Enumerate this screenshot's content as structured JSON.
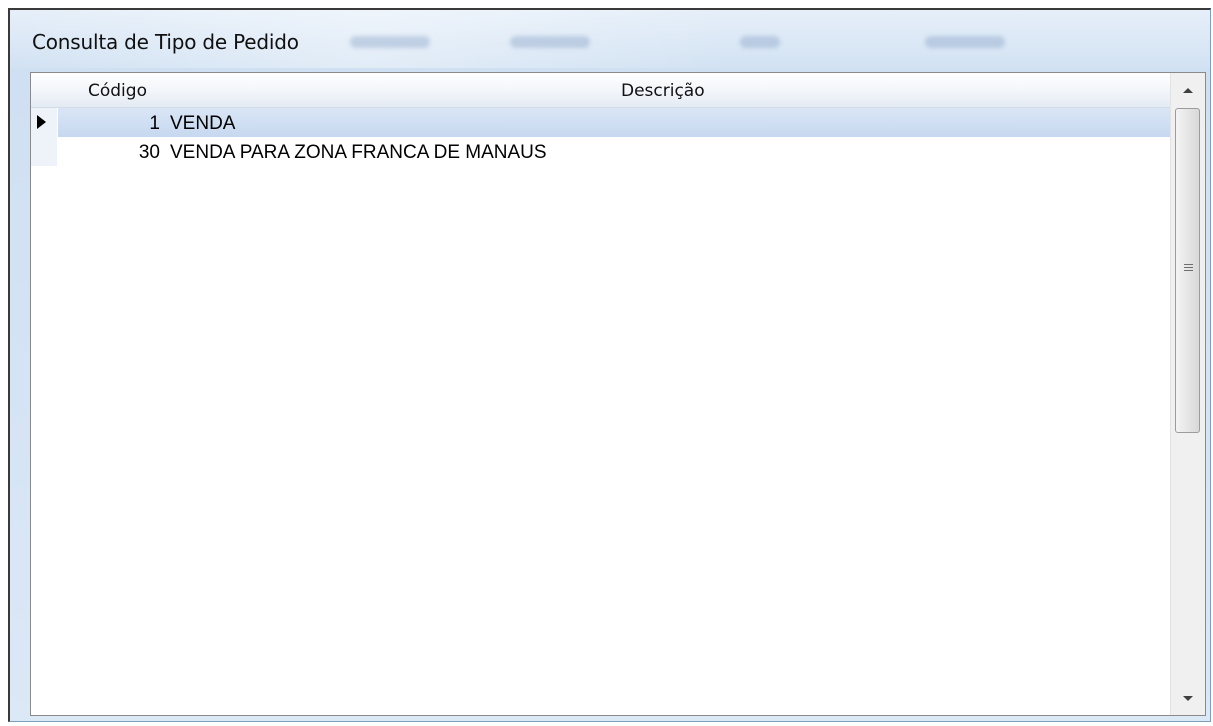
{
  "window": {
    "title": "Consulta de Tipo de Pedido"
  },
  "grid": {
    "columns": [
      {
        "key": "codigo",
        "label": "Código"
      },
      {
        "key": "descricao",
        "label": "Descrição"
      }
    ],
    "rows": [
      {
        "codigo": "1",
        "descricao": "VENDA",
        "selected": true
      },
      {
        "codigo": "30",
        "descricao": "VENDA PARA ZONA FRANCA DE MANAUS",
        "selected": false
      }
    ],
    "selection_color": "#c6d8ef"
  },
  "scrollbar": {
    "up_icon": "triangle-up-icon",
    "down_icon": "triangle-down-icon",
    "grip_icon": "grip-lines-icon"
  }
}
